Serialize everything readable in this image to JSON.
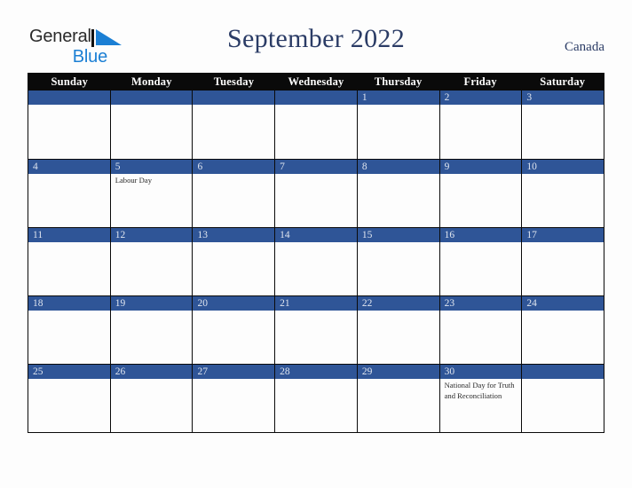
{
  "brand": {
    "line1": "General",
    "line2": "Blue",
    "mark_color": "#1b7fd4"
  },
  "header": {
    "title": "September 2022",
    "country": "Canada"
  },
  "colors": {
    "date_bar": "#2f5597",
    "header_bar": "#0a0a0a",
    "title_text": "#2b3c66",
    "brand_blue": "#1b7fd4",
    "cell_bg": "#fdfdfd"
  },
  "day_names": [
    "Sunday",
    "Monday",
    "Tuesday",
    "Wednesday",
    "Thursday",
    "Friday",
    "Saturday"
  ],
  "weeks": [
    [
      {
        "date": "",
        "events": []
      },
      {
        "date": "",
        "events": []
      },
      {
        "date": "",
        "events": []
      },
      {
        "date": "",
        "events": []
      },
      {
        "date": "1",
        "events": []
      },
      {
        "date": "2",
        "events": []
      },
      {
        "date": "3",
        "events": []
      }
    ],
    [
      {
        "date": "4",
        "events": []
      },
      {
        "date": "5",
        "events": [
          "Labour Day"
        ]
      },
      {
        "date": "6",
        "events": []
      },
      {
        "date": "7",
        "events": []
      },
      {
        "date": "8",
        "events": []
      },
      {
        "date": "9",
        "events": []
      },
      {
        "date": "10",
        "events": []
      }
    ],
    [
      {
        "date": "11",
        "events": []
      },
      {
        "date": "12",
        "events": []
      },
      {
        "date": "13",
        "events": []
      },
      {
        "date": "14",
        "events": []
      },
      {
        "date": "15",
        "events": []
      },
      {
        "date": "16",
        "events": []
      },
      {
        "date": "17",
        "events": []
      }
    ],
    [
      {
        "date": "18",
        "events": []
      },
      {
        "date": "19",
        "events": []
      },
      {
        "date": "20",
        "events": []
      },
      {
        "date": "21",
        "events": []
      },
      {
        "date": "22",
        "events": []
      },
      {
        "date": "23",
        "events": []
      },
      {
        "date": "24",
        "events": []
      }
    ],
    [
      {
        "date": "25",
        "events": []
      },
      {
        "date": "26",
        "events": []
      },
      {
        "date": "27",
        "events": []
      },
      {
        "date": "28",
        "events": []
      },
      {
        "date": "29",
        "events": []
      },
      {
        "date": "30",
        "events": [
          "National Day for Truth and Reconciliation"
        ]
      },
      {
        "date": "",
        "events": []
      }
    ]
  ]
}
